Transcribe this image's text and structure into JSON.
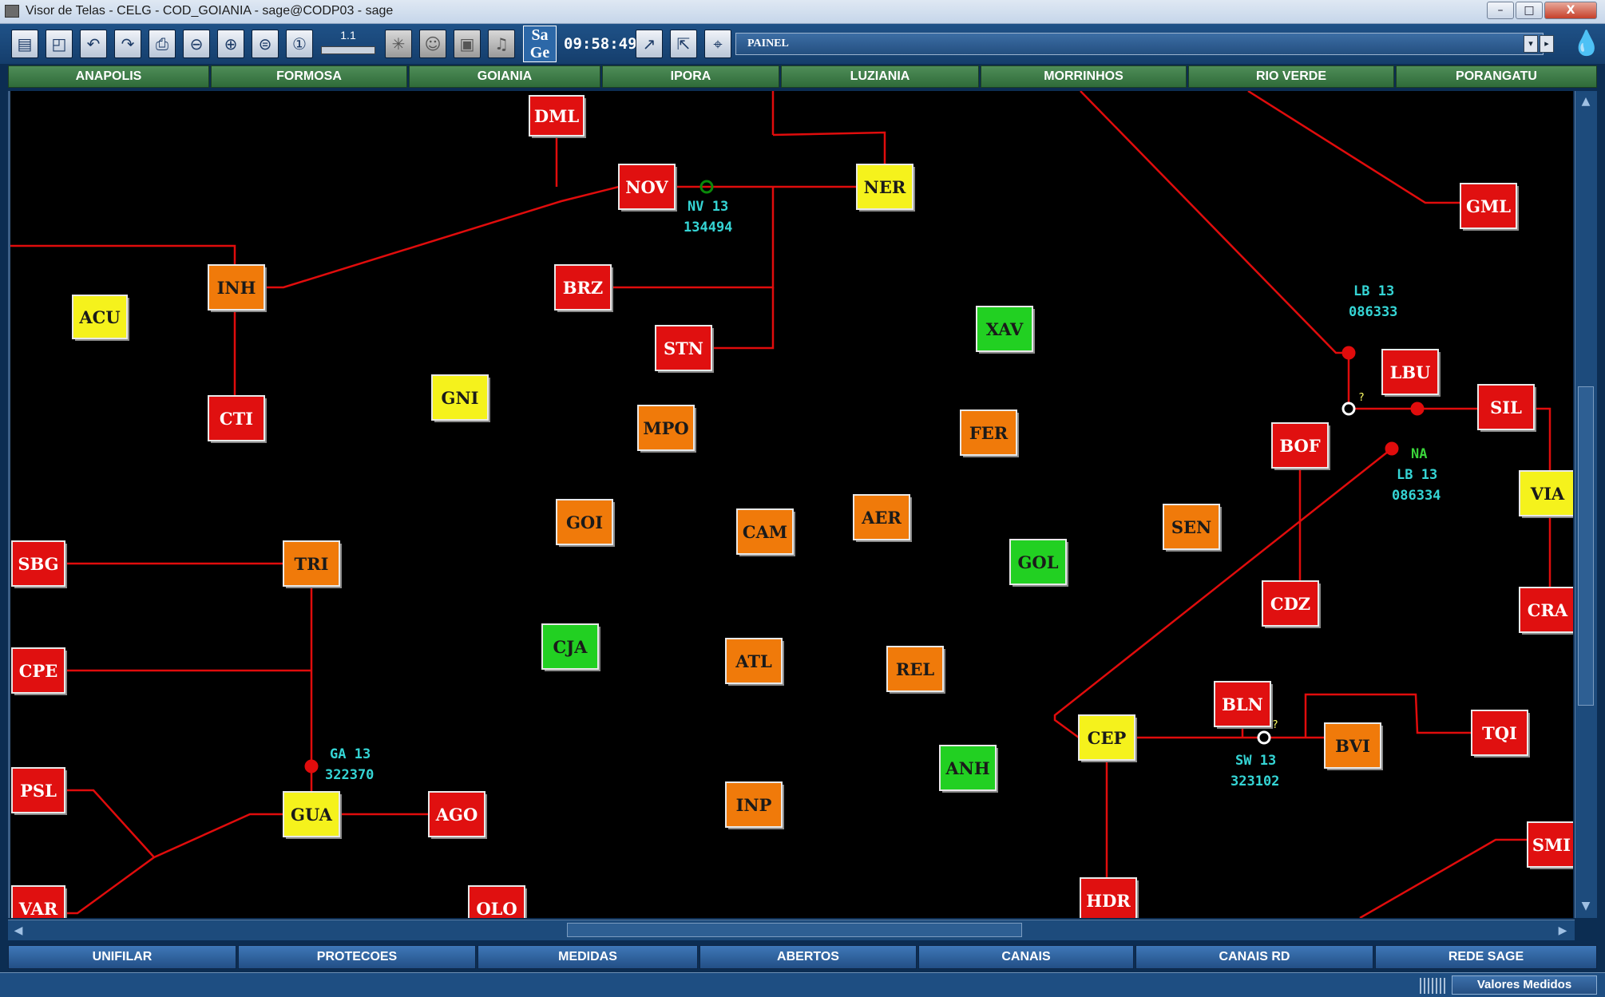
{
  "window": {
    "title": "Visor de Telas - CELG - COD_GOIANIA  - sage@CODP03 - sage",
    "controls": {
      "minimize": "–",
      "maximize": "□",
      "close": "X"
    }
  },
  "toolbar": {
    "buttons": [
      {
        "name": "screen-list-icon",
        "glyph": "▤"
      },
      {
        "name": "open-screen-icon",
        "glyph": "◰"
      },
      {
        "name": "back-screen-icon",
        "glyph": "↶"
      },
      {
        "name": "forward-screen-icon",
        "glyph": "↷"
      },
      {
        "name": "print-icon",
        "glyph": "⎙"
      },
      {
        "name": "zoom-out-icon",
        "glyph": "⊖"
      },
      {
        "name": "zoom-in-icon",
        "glyph": "⊕"
      },
      {
        "name": "zoom-area-icon",
        "glyph": "⊜"
      },
      {
        "name": "zoom-reset-icon",
        "glyph": "①"
      }
    ],
    "zoom_level": "1.1",
    "extra_buttons": [
      {
        "name": "settings-icon",
        "glyph": "✳",
        "gray": true
      },
      {
        "name": "users-icon",
        "glyph": "☺",
        "gray": true
      },
      {
        "name": "windows-icon",
        "glyph": "▣",
        "gray": true
      },
      {
        "name": "sound-icon",
        "glyph": "♫",
        "gray": true
      }
    ],
    "sage_logo": "Sa\nGe",
    "clock": "09:58:49",
    "nav_buttons": [
      {
        "name": "pointer-icon",
        "glyph": "↗"
      },
      {
        "name": "navigate-icon",
        "glyph": "⇱"
      },
      {
        "name": "pin-icon",
        "glyph": "⌖"
      }
    ],
    "painel_label": "PAINEL",
    "painel_arrows": [
      "▾",
      "▸"
    ]
  },
  "regions": [
    "ANAPOLIS",
    "FORMOSA",
    "GOIANIA",
    "IPORA",
    "LUZIANIA",
    "MORRINHOS",
    "RIO VERDE",
    "PORANGATU"
  ],
  "colors": {
    "red": "#e01010",
    "orange": "#f07a0a",
    "yellow": "#f5f21c",
    "green": "#22d022",
    "line": "#e00c0c",
    "background": "#000000",
    "measure_cyan": "#35d5d5"
  },
  "stations": [
    {
      "code": "DML",
      "status": "red"
    },
    {
      "code": "NOV",
      "status": "red"
    },
    {
      "code": "NER",
      "status": "yellow"
    },
    {
      "code": "GML",
      "status": "red"
    },
    {
      "code": "INH",
      "status": "orange"
    },
    {
      "code": "ACU",
      "status": "yellow"
    },
    {
      "code": "BRZ",
      "status": "red"
    },
    {
      "code": "STN",
      "status": "red"
    },
    {
      "code": "XAV",
      "status": "green"
    },
    {
      "code": "LBU",
      "status": "red"
    },
    {
      "code": "CTI",
      "status": "red"
    },
    {
      "code": "GNI",
      "status": "yellow"
    },
    {
      "code": "MPO",
      "status": "orange"
    },
    {
      "code": "FER",
      "status": "orange"
    },
    {
      "code": "SIL",
      "status": "red"
    },
    {
      "code": "BOF",
      "status": "red"
    },
    {
      "code": "GOI",
      "status": "orange"
    },
    {
      "code": "CAM",
      "status": "orange"
    },
    {
      "code": "AER",
      "status": "orange"
    },
    {
      "code": "SEN",
      "status": "orange"
    },
    {
      "code": "VIA",
      "status": "yellow"
    },
    {
      "code": "SBG",
      "status": "red"
    },
    {
      "code": "TRI",
      "status": "orange"
    },
    {
      "code": "GOL",
      "status": "green"
    },
    {
      "code": "CDZ",
      "status": "red"
    },
    {
      "code": "CRA",
      "status": "red"
    },
    {
      "code": "CJA",
      "status": "green"
    },
    {
      "code": "CPE",
      "status": "red"
    },
    {
      "code": "ATL",
      "status": "orange"
    },
    {
      "code": "REL",
      "status": "orange"
    },
    {
      "code": "BLN",
      "status": "red"
    },
    {
      "code": "TQI",
      "status": "red"
    },
    {
      "code": "CEP",
      "status": "yellow"
    },
    {
      "code": "BVI",
      "status": "orange"
    },
    {
      "code": "ANH",
      "status": "green"
    },
    {
      "code": "PSL",
      "status": "red"
    },
    {
      "code": "INP",
      "status": "orange"
    },
    {
      "code": "GUA",
      "status": "yellow"
    },
    {
      "code": "AGO",
      "status": "red"
    },
    {
      "code": "SMI",
      "status": "red"
    },
    {
      "code": "VAR",
      "status": "red"
    },
    {
      "code": "OLO",
      "status": "red"
    },
    {
      "code": "HDR",
      "status": "red"
    }
  ],
  "measurements": [
    {
      "line1": "NV 13",
      "line2": "134494"
    },
    {
      "line1": "LB 13",
      "line2": "086333"
    },
    {
      "line1": "NA",
      "line2": "LB 13",
      "line3": "086334"
    },
    {
      "line1": "GA 13",
      "line2": "322370"
    },
    {
      "line1": "SW 13",
      "line2": "323102"
    }
  ],
  "question_marks": [
    "?",
    "?"
  ],
  "scroll_arrows": {
    "up": "▲",
    "down": "▼",
    "left": "◀",
    "right": "▶"
  },
  "bottom_tabs": [
    "UNIFILAR",
    "PROTECOES",
    "MEDIDAS",
    "ABERTOS",
    "CANAIS",
    "CANAIS RD",
    "REDE SAGE"
  ],
  "status_bar": {
    "text": "Valores Medidos"
  }
}
